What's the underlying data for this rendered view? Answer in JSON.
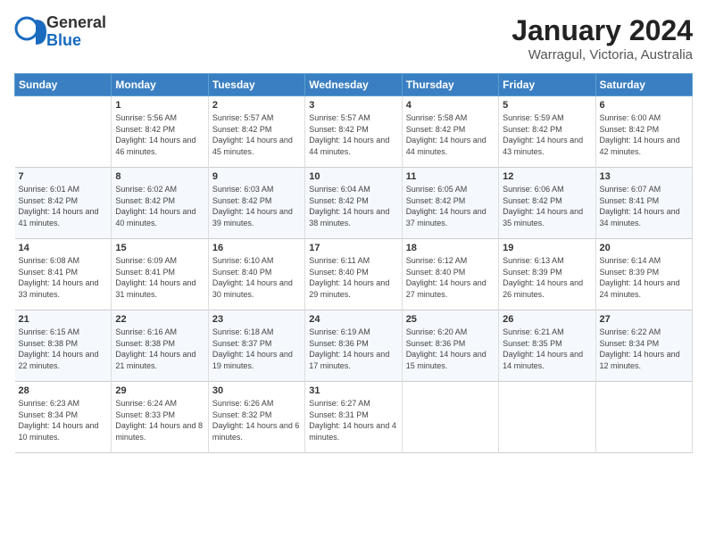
{
  "header": {
    "logo": {
      "line1": "General",
      "line2": "Blue"
    },
    "title": "January 2024",
    "location": "Warragul, Victoria, Australia"
  },
  "weekdays": [
    "Sunday",
    "Monday",
    "Tuesday",
    "Wednesday",
    "Thursday",
    "Friday",
    "Saturday"
  ],
  "weeks": [
    [
      {
        "day": "",
        "sunrise": "",
        "sunset": "",
        "daylight": ""
      },
      {
        "day": "1",
        "sunrise": "Sunrise: 5:56 AM",
        "sunset": "Sunset: 8:42 PM",
        "daylight": "Daylight: 14 hours and 46 minutes."
      },
      {
        "day": "2",
        "sunrise": "Sunrise: 5:57 AM",
        "sunset": "Sunset: 8:42 PM",
        "daylight": "Daylight: 14 hours and 45 minutes."
      },
      {
        "day": "3",
        "sunrise": "Sunrise: 5:57 AM",
        "sunset": "Sunset: 8:42 PM",
        "daylight": "Daylight: 14 hours and 44 minutes."
      },
      {
        "day": "4",
        "sunrise": "Sunrise: 5:58 AM",
        "sunset": "Sunset: 8:42 PM",
        "daylight": "Daylight: 14 hours and 44 minutes."
      },
      {
        "day": "5",
        "sunrise": "Sunrise: 5:59 AM",
        "sunset": "Sunset: 8:42 PM",
        "daylight": "Daylight: 14 hours and 43 minutes."
      },
      {
        "day": "6",
        "sunrise": "Sunrise: 6:00 AM",
        "sunset": "Sunset: 8:42 PM",
        "daylight": "Daylight: 14 hours and 42 minutes."
      }
    ],
    [
      {
        "day": "7",
        "sunrise": "Sunrise: 6:01 AM",
        "sunset": "Sunset: 8:42 PM",
        "daylight": "Daylight: 14 hours and 41 minutes."
      },
      {
        "day": "8",
        "sunrise": "Sunrise: 6:02 AM",
        "sunset": "Sunset: 8:42 PM",
        "daylight": "Daylight: 14 hours and 40 minutes."
      },
      {
        "day": "9",
        "sunrise": "Sunrise: 6:03 AM",
        "sunset": "Sunset: 8:42 PM",
        "daylight": "Daylight: 14 hours and 39 minutes."
      },
      {
        "day": "10",
        "sunrise": "Sunrise: 6:04 AM",
        "sunset": "Sunset: 8:42 PM",
        "daylight": "Daylight: 14 hours and 38 minutes."
      },
      {
        "day": "11",
        "sunrise": "Sunrise: 6:05 AM",
        "sunset": "Sunset: 8:42 PM",
        "daylight": "Daylight: 14 hours and 37 minutes."
      },
      {
        "day": "12",
        "sunrise": "Sunrise: 6:06 AM",
        "sunset": "Sunset: 8:42 PM",
        "daylight": "Daylight: 14 hours and 35 minutes."
      },
      {
        "day": "13",
        "sunrise": "Sunrise: 6:07 AM",
        "sunset": "Sunset: 8:41 PM",
        "daylight": "Daylight: 14 hours and 34 minutes."
      }
    ],
    [
      {
        "day": "14",
        "sunrise": "Sunrise: 6:08 AM",
        "sunset": "Sunset: 8:41 PM",
        "daylight": "Daylight: 14 hours and 33 minutes."
      },
      {
        "day": "15",
        "sunrise": "Sunrise: 6:09 AM",
        "sunset": "Sunset: 8:41 PM",
        "daylight": "Daylight: 14 hours and 31 minutes."
      },
      {
        "day": "16",
        "sunrise": "Sunrise: 6:10 AM",
        "sunset": "Sunset: 8:40 PM",
        "daylight": "Daylight: 14 hours and 30 minutes."
      },
      {
        "day": "17",
        "sunrise": "Sunrise: 6:11 AM",
        "sunset": "Sunset: 8:40 PM",
        "daylight": "Daylight: 14 hours and 29 minutes."
      },
      {
        "day": "18",
        "sunrise": "Sunrise: 6:12 AM",
        "sunset": "Sunset: 8:40 PM",
        "daylight": "Daylight: 14 hours and 27 minutes."
      },
      {
        "day": "19",
        "sunrise": "Sunrise: 6:13 AM",
        "sunset": "Sunset: 8:39 PM",
        "daylight": "Daylight: 14 hours and 26 minutes."
      },
      {
        "day": "20",
        "sunrise": "Sunrise: 6:14 AM",
        "sunset": "Sunset: 8:39 PM",
        "daylight": "Daylight: 14 hours and 24 minutes."
      }
    ],
    [
      {
        "day": "21",
        "sunrise": "Sunrise: 6:15 AM",
        "sunset": "Sunset: 8:38 PM",
        "daylight": "Daylight: 14 hours and 22 minutes."
      },
      {
        "day": "22",
        "sunrise": "Sunrise: 6:16 AM",
        "sunset": "Sunset: 8:38 PM",
        "daylight": "Daylight: 14 hours and 21 minutes."
      },
      {
        "day": "23",
        "sunrise": "Sunrise: 6:18 AM",
        "sunset": "Sunset: 8:37 PM",
        "daylight": "Daylight: 14 hours and 19 minutes."
      },
      {
        "day": "24",
        "sunrise": "Sunrise: 6:19 AM",
        "sunset": "Sunset: 8:36 PM",
        "daylight": "Daylight: 14 hours and 17 minutes."
      },
      {
        "day": "25",
        "sunrise": "Sunrise: 6:20 AM",
        "sunset": "Sunset: 8:36 PM",
        "daylight": "Daylight: 14 hours and 15 minutes."
      },
      {
        "day": "26",
        "sunrise": "Sunrise: 6:21 AM",
        "sunset": "Sunset: 8:35 PM",
        "daylight": "Daylight: 14 hours and 14 minutes."
      },
      {
        "day": "27",
        "sunrise": "Sunrise: 6:22 AM",
        "sunset": "Sunset: 8:34 PM",
        "daylight": "Daylight: 14 hours and 12 minutes."
      }
    ],
    [
      {
        "day": "28",
        "sunrise": "Sunrise: 6:23 AM",
        "sunset": "Sunset: 8:34 PM",
        "daylight": "Daylight: 14 hours and 10 minutes."
      },
      {
        "day": "29",
        "sunrise": "Sunrise: 6:24 AM",
        "sunset": "Sunset: 8:33 PM",
        "daylight": "Daylight: 14 hours and 8 minutes."
      },
      {
        "day": "30",
        "sunrise": "Sunrise: 6:26 AM",
        "sunset": "Sunset: 8:32 PM",
        "daylight": "Daylight: 14 hours and 6 minutes."
      },
      {
        "day": "31",
        "sunrise": "Sunrise: 6:27 AM",
        "sunset": "Sunset: 8:31 PM",
        "daylight": "Daylight: 14 hours and 4 minutes."
      },
      {
        "day": "",
        "sunrise": "",
        "sunset": "",
        "daylight": ""
      },
      {
        "day": "",
        "sunrise": "",
        "sunset": "",
        "daylight": ""
      },
      {
        "day": "",
        "sunrise": "",
        "sunset": "",
        "daylight": ""
      }
    ]
  ]
}
